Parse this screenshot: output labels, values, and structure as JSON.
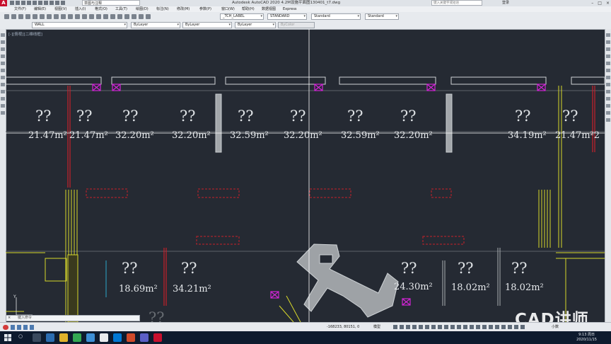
{
  "app": {
    "title": "Autodesk AutoCAD 2020    4.2M设施平面图130401_t7.dwg",
    "workspace": "草图与注释",
    "search_placeholder": "键入关键字或短语",
    "login": "登录"
  },
  "menus": [
    "文件(F)",
    "编辑(E)",
    "视图(V)",
    "插入(I)",
    "格式(O)",
    "工具(T)",
    "绘图(D)",
    "标注(N)",
    "修改(M)",
    "参数(P)",
    "窗口(W)",
    "帮助(H)",
    "数据视图",
    "Express"
  ],
  "toolbar1": {
    "text_style": "_TCH_LABEL",
    "dim_style": "STANDARD",
    "table_style": "Standard",
    "mleader_style": "Standard"
  },
  "toolbar2": {
    "layer": "WALL",
    "color": "ByLayer",
    "linetype": "ByLayer",
    "lineweight": "ByLayer",
    "plotstyle": "ByColor"
  },
  "viewport_label": "[-][俯视][二维线框]",
  "rooms_top": [
    {
      "q": "??",
      "area": "21.47m²"
    },
    {
      "q": "??",
      "area": "21.47m²"
    },
    {
      "q": "??",
      "area": "32.20m²"
    },
    {
      "q": "??",
      "area": "32.20m²"
    },
    {
      "q": "??",
      "area": "32.59m²"
    },
    {
      "q": "??",
      "area": "32.20m²"
    },
    {
      "q": "??",
      "area": "32.59m²"
    },
    {
      "q": "??",
      "area": "32.20m²"
    },
    {
      "q": "??",
      "area": "34.19m²"
    },
    {
      "q": "??",
      "area": "21.47m²2"
    }
  ],
  "rooms_bottom": [
    {
      "q": "??",
      "area": "18.69m²"
    },
    {
      "q": "??",
      "area": "34.21m²"
    },
    {
      "q": "??",
      "area": "24.30m²"
    },
    {
      "q": "??",
      "area": "18.02m²"
    },
    {
      "q": "??",
      "area": "18.02m²"
    }
  ],
  "cropped_bottom_q": "??",
  "ucs_label": "Y",
  "command_placeholder": "键入命令",
  "status": {
    "coordinates": "-168233, 80151, 0",
    "mode": "模型",
    "scale": "1:1 / 100%",
    "units": "小数"
  },
  "clock": {
    "time": "9:13 周日",
    "date": "2020/11/15"
  },
  "watermark": "CAD讲师",
  "colors": {
    "canvas": "#252a33",
    "wall": "#cfd3d6",
    "red": "#c8202a",
    "magenta": "#d225d6",
    "yellow": "#d8d82a",
    "cyan": "#2aa7c8",
    "crosshair": "#ffffff"
  }
}
